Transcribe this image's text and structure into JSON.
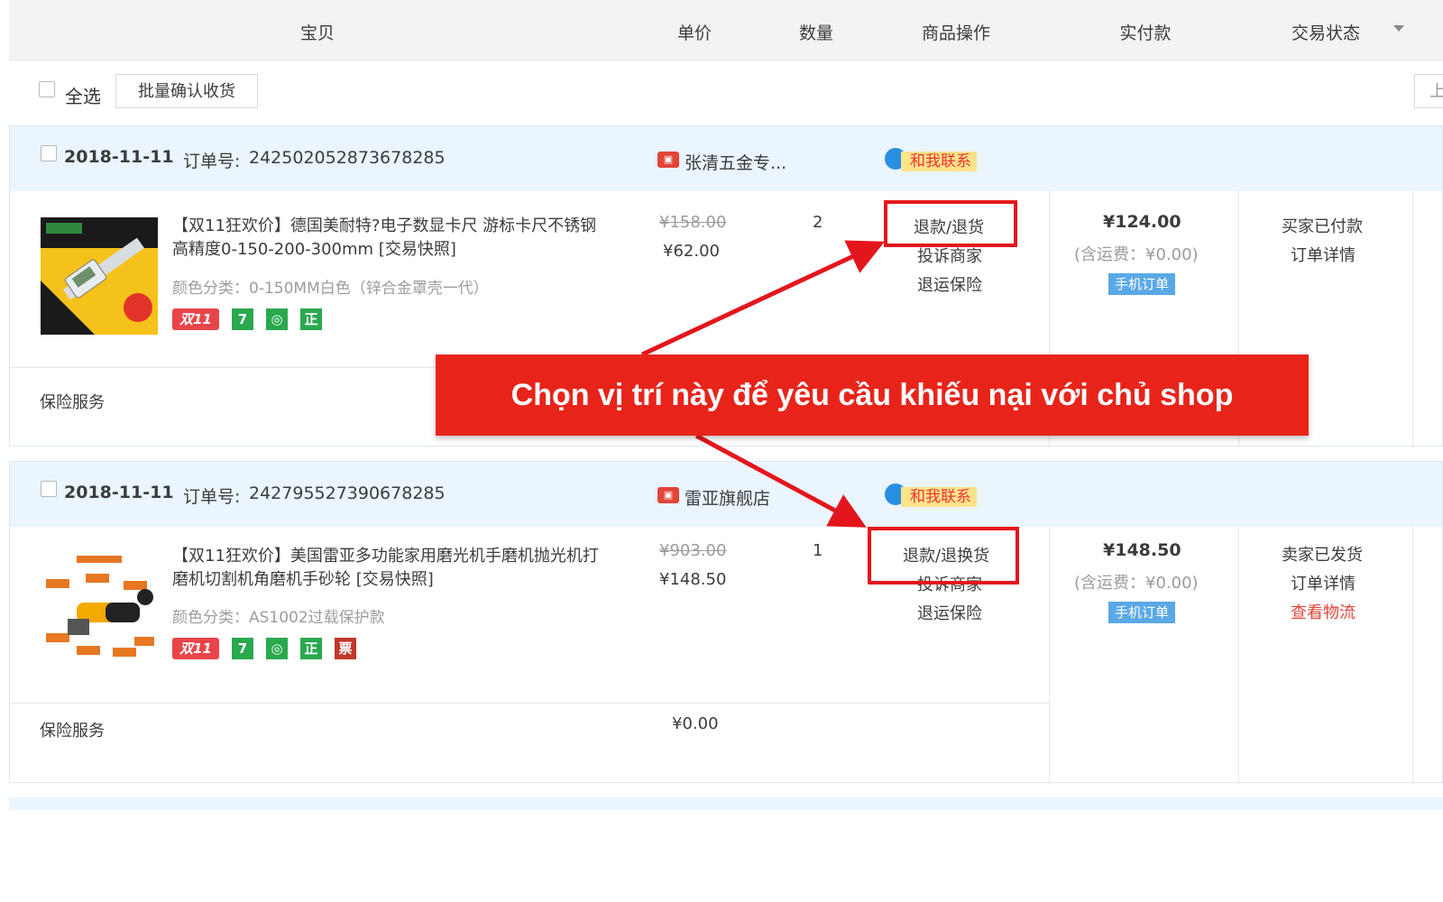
{
  "header": {
    "columns": [
      "宝贝",
      "单价",
      "数量",
      "商品操作",
      "实付款",
      "交易状态"
    ]
  },
  "toolbar": {
    "select_all": "全选",
    "batch_confirm": "批量确认收货",
    "pager_partial": "上"
  },
  "orders": [
    {
      "date": "2018-11-11",
      "order_no_label": "订单号:",
      "order_no": "242502052873678285",
      "shop_name": "张清五金专...",
      "contact": "和我联系",
      "item": {
        "title": "【双11狂欢价】德国美耐特?电子数显卡尺 游标卡尺不锈钢高精度0-150-200-300mm [交易快照]",
        "sku": "颜色分类：0-150MM白色（锌合金罩壳一代）",
        "badges": [
          "双11",
          "7",
          "◎",
          "正"
        ],
        "orig_price": "¥158.00",
        "price": "¥62.00",
        "qty": "2",
        "ops": [
          "退款/退货",
          "投诉商家",
          "退运保险"
        ],
        "paid": "¥124.00",
        "shipping": "(含运费：¥0.00)",
        "mobile": "手机订单",
        "status": [
          "买家已付款",
          "订单详情"
        ]
      },
      "insurance_label": "保险服务"
    },
    {
      "date": "2018-11-11",
      "order_no_label": "订单号:",
      "order_no": "242795527390678285",
      "shop_name": "雷亚旗舰店",
      "contact": "和我联系",
      "item": {
        "title": "【双11狂欢价】美国雷亚多功能家用磨光机手磨机抛光机打磨机切割机角磨机手砂轮 [交易快照]",
        "sku": "颜色分类：AS1002过载保护款",
        "badges": [
          "双11",
          "7",
          "◎",
          "正",
          "票"
        ],
        "orig_price": "¥903.00",
        "price": "¥148.50",
        "qty": "1",
        "ops": [
          "退款/退换货",
          "投诉商家",
          "退运保险"
        ],
        "paid": "¥148.50",
        "shipping": "(含运费：¥0.00)",
        "mobile": "手机订单",
        "status": [
          "卖家已发货",
          "订单详情",
          "查看物流"
        ]
      },
      "insurance_label": "保险服务",
      "insurance_price": "¥0.00"
    }
  ],
  "annotation": {
    "banner_text": "Chọn vị trí này để yêu cầu khiếu nại với chủ shop"
  },
  "colors": {
    "highlight_red": "#e4161d",
    "banner_red": "#e8241a",
    "order_head_bg": "#eaf5fd",
    "header_bg": "#f3f3f3"
  }
}
